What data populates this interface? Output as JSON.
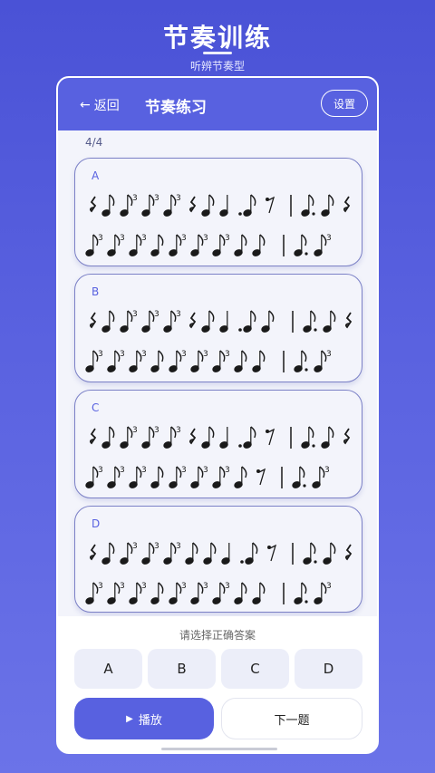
{
  "hero": {
    "title": "节奏训练",
    "subtitle": "听辨节奏型"
  },
  "appbar": {
    "back_icon": "←",
    "back_label": "返回",
    "title": "节奏练习",
    "settings_label": "设置"
  },
  "progress": "4/4",
  "options": [
    {
      "letter": "A",
      "row1": [
        "r",
        "e",
        "e3",
        "e3",
        "e3",
        "r",
        "e",
        "q",
        "dot",
        "e",
        "r8",
        "bar",
        "ed",
        "e",
        "r"
      ],
      "row2": [
        "e3",
        "e3",
        "e3",
        "e",
        "e3",
        "e3",
        "e3",
        "e",
        "e",
        "bar",
        "ed",
        "e3"
      ]
    },
    {
      "letter": "B",
      "row1": [
        "r",
        "e",
        "e3",
        "e3",
        "e3",
        "r",
        "e",
        "q",
        "dot",
        "e",
        "e",
        "bar",
        "ed",
        "e",
        "r"
      ],
      "row2": [
        "e3",
        "e3",
        "e3",
        "e",
        "e3",
        "e3",
        "e3",
        "e",
        "e",
        "bar",
        "ed",
        "e3"
      ]
    },
    {
      "letter": "C",
      "row1": [
        "r",
        "e",
        "e3",
        "e3",
        "e3",
        "r",
        "e",
        "q",
        "dot",
        "e",
        "r8",
        "bar",
        "ed",
        "e",
        "r"
      ],
      "row2": [
        "e3",
        "e3",
        "e3",
        "e",
        "e3",
        "e3",
        "e3",
        "e",
        "r8",
        "bar",
        "ed",
        "e3"
      ]
    },
    {
      "letter": "D",
      "row1": [
        "r",
        "e",
        "e3",
        "e3",
        "e3",
        "e",
        "e",
        "q",
        "dot",
        "e",
        "r8",
        "bar",
        "ed",
        "e",
        "r"
      ],
      "row2": [
        "e3",
        "e3",
        "e3",
        "e",
        "e3",
        "e3",
        "e3",
        "e",
        "e",
        "bar",
        "ed",
        "e3"
      ]
    }
  ],
  "answer": {
    "prompt": "请选择正确答案",
    "choices": [
      "A",
      "B",
      "C",
      "D"
    ]
  },
  "actions": {
    "play_icon": "▶",
    "play_label": "播放",
    "next_label": "下一题"
  },
  "colors": {
    "accent": "#5861e0",
    "card_border": "#7b80c6",
    "note": "#1a1a1a"
  }
}
